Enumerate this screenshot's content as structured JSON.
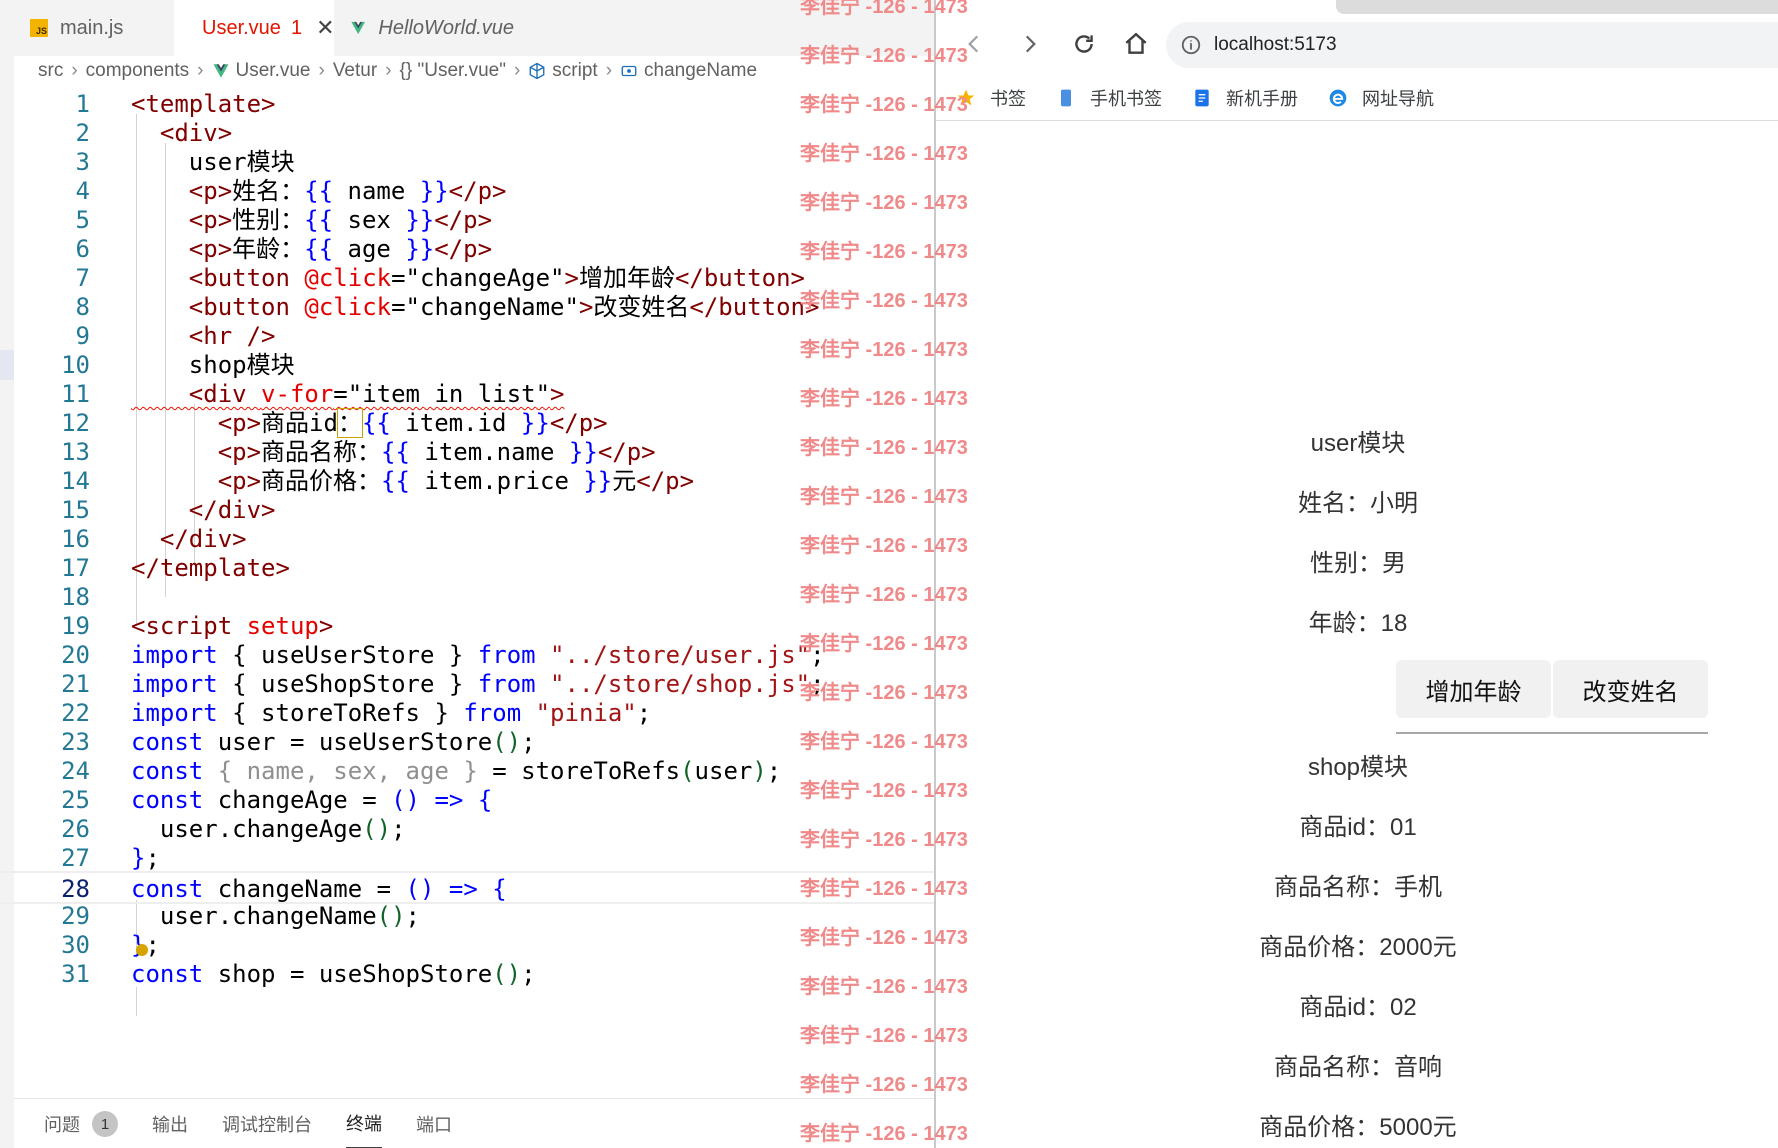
{
  "editor": {
    "tabs": [
      {
        "label": "main.js",
        "type": "js"
      },
      {
        "label": "User.vue",
        "badge": "1",
        "active": true
      },
      {
        "label": "HelloWorld.vue",
        "italic": true
      }
    ],
    "breadcrumb": [
      "src",
      "components",
      "User.vue",
      "Vetur",
      "{} \"User.vue\"",
      "script",
      "changeName"
    ],
    "line_numbers": [
      "1",
      "2",
      "3",
      "4",
      "5",
      "6",
      "7",
      "8",
      "9",
      "10",
      "11",
      "12",
      "13",
      "14",
      "15",
      "16",
      "17",
      "18",
      "19",
      "20",
      "21",
      "22",
      "23",
      "24",
      "25",
      "26",
      "27",
      "28",
      "29",
      "30",
      "31"
    ],
    "code": {
      "l1": [
        "<template>"
      ],
      "l2": [
        "  <div>"
      ],
      "l3": [
        "    user模块"
      ],
      "l4": [
        "    <p>",
        "姓名：",
        "{{",
        " name ",
        "}}",
        "</p>"
      ],
      "l5": [
        "    <p>",
        "性别：",
        "{{",
        " sex ",
        "}}",
        "</p>"
      ],
      "l6": [
        "    <p>",
        "年龄：",
        "{{",
        " age ",
        "}}",
        "</p>"
      ],
      "l7": [
        "    <button ",
        "@click",
        "=",
        "\"changeAge\"",
        ">",
        "增加年龄",
        "</button>"
      ],
      "l8": [
        "    <button ",
        "@click",
        "=",
        "\"changeName\"",
        ">",
        "改变姓名",
        "</button>"
      ],
      "l9": [
        "    <hr />"
      ],
      "l10": [
        "    shop模块"
      ],
      "l11": [
        "    <div ",
        "v-for",
        "=",
        "\"item in list\"",
        ">"
      ],
      "l12": [
        "      <p>",
        "商品id",
        "：",
        "{{",
        " item.id ",
        "}}",
        "</p>"
      ],
      "l13": [
        "      <p>",
        "商品名称：",
        "{{",
        " item.name ",
        "}}",
        "</p>"
      ],
      "l14": [
        "      <p>",
        "商品价格：",
        "{{",
        " item.price ",
        "}}",
        "元",
        "</p>"
      ],
      "l15": [
        "    </div>"
      ],
      "l16": [
        "  </div>"
      ],
      "l17": [
        "</template>"
      ],
      "l18": [
        ""
      ],
      "l19": [
        "<script ",
        "setup",
        ">"
      ],
      "l20": [
        "import",
        " { useUserStore } ",
        "from",
        " ",
        "\"../store/user.js\"",
        ";"
      ],
      "l21": [
        "import",
        " { useShopStore } ",
        "from",
        " ",
        "\"../store/shop.js\"",
        ";"
      ],
      "l22": [
        "import",
        " { storeToRefs } ",
        "from",
        " ",
        "\"pinia\"",
        ";"
      ],
      "l23": [
        "const",
        " user = useUserStore",
        "()",
        ";"
      ],
      "l24": [
        "const",
        " ",
        "{ name, sex, age }",
        " = storeToRefs",
        "(",
        "user",
        ")",
        ";"
      ],
      "l25": [
        "const",
        " changeAge = ",
        "()",
        " ",
        "=>",
        " ",
        "{"
      ],
      "l26": [
        "  user.changeAge",
        "()",
        ";"
      ],
      "l27": [
        "}",
        ";"
      ],
      "l28": [
        "const",
        " changeName = ",
        "()",
        " ",
        "=>",
        " ",
        "{"
      ],
      "l29": [
        "  user.changeName",
        "()",
        ";"
      ],
      "l30": [
        "}",
        ";"
      ],
      "l31": [
        "const",
        " shop = useShopStore",
        "()",
        ";"
      ]
    },
    "panel": {
      "tabs": [
        "问题",
        "输出",
        "调试控制台",
        "终端",
        "端口"
      ],
      "problem_count": "1",
      "active": "终端"
    }
  },
  "watermark": "李佳宁 -126 - 1473",
  "browser": {
    "url": "localhost:5173",
    "bookmarks": [
      "书签",
      "手机书签",
      "新机手册",
      "网址导航"
    ],
    "page": {
      "user_heading": "user模块",
      "name_line": "姓名：小明",
      "sex_line": "性别：男",
      "age_line": "年龄：18",
      "btn_age": "增加年龄",
      "btn_name": "改变姓名",
      "shop_heading": "shop模块",
      "items": [
        {
          "id_line": "商品id：01",
          "name_line": "商品名称：手机",
          "price_line": "商品价格：2000元"
        },
        {
          "id_line": "商品id：02",
          "name_line": "商品名称：音响",
          "price_line": "商品价格：5000元"
        }
      ]
    }
  },
  "colors": {
    "tag": "#800000",
    "attribute": "#e50000",
    "string": "#a31515",
    "keyword": "#0000ff",
    "line_number": "#237893",
    "watermark": "#f08a8a",
    "error": "#e51400"
  }
}
